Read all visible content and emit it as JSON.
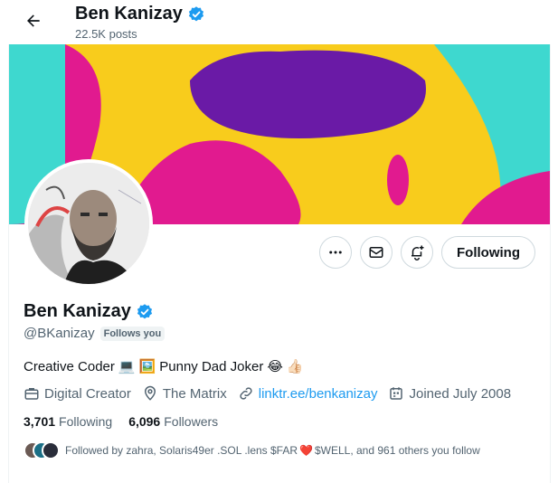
{
  "header": {
    "name": "Ben Kanizay",
    "posts": "22.5K posts"
  },
  "profile": {
    "name": "Ben Kanizay",
    "handle": "@BKanizay",
    "follows_you": "Follows you",
    "bio_parts": [
      "Creative Coder",
      "Punny Dad Joker"
    ],
    "category": "Digital Creator",
    "location": "The Matrix",
    "website": "linktr.ee/benkanizay",
    "joined": "Joined July 2008",
    "following_count": "3,701",
    "following_label": "Following",
    "followers_count": "6,096",
    "followers_label": "Followers",
    "followed_by_prefix": "Followed by zahra, Solaris49er .SOL .lens $FAR",
    "followed_by_suffix": "$WELL, and 961 others you follow"
  },
  "actions": {
    "follow_label": "Following"
  },
  "icons": {
    "back": "arrow-left-icon",
    "verified": "verified-badge-icon",
    "more": "more-horizontal-icon",
    "message": "envelope-icon",
    "notify": "bell-plus-icon",
    "category": "briefcase-icon",
    "location": "location-pin-icon",
    "link": "link-icon",
    "calendar": "calendar-icon"
  },
  "colors": {
    "accent": "#1d9bf0",
    "text": "#0f1419",
    "muted": "#536471",
    "border": "#cfd9de",
    "banner_teal": "#3ed8cf",
    "banner_magenta": "#e11a8f",
    "banner_yellow": "#f8cc1c",
    "banner_purple": "#6a1aa6"
  }
}
